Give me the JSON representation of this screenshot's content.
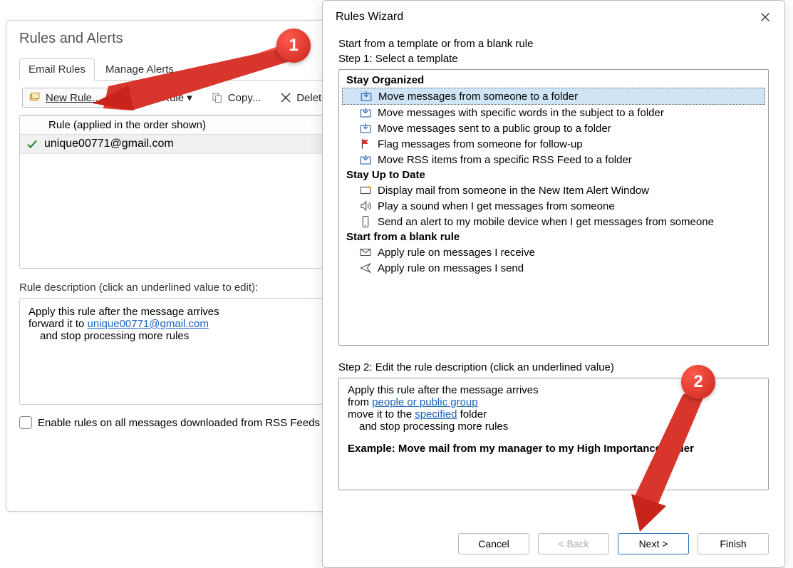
{
  "back": {
    "title": "Rules and Alerts",
    "tabs": {
      "email_rules": "Email Rules",
      "manage_alerts": "Manage Alerts"
    },
    "toolbar": {
      "new_rule": "New Rule...",
      "change_rule": "Change Rule",
      "copy": "Copy...",
      "delete": "Delete"
    },
    "list": {
      "header": "Rule (applied in the order shown)",
      "rows": [
        "unique00771@gmail.com"
      ]
    },
    "descr_label": "Rule description (click an underlined value to edit):",
    "descr": {
      "line1": "Apply this rule after the message arrives",
      "line2_pre": "forward it to ",
      "line2_link": "unique00771@gmail.com",
      "line3": "and stop processing more rules"
    },
    "rss_checkbox": "Enable rules on all messages downloaded from RSS Feeds"
  },
  "wizard": {
    "title": "Rules Wizard",
    "intro": "Start from a template or from a blank rule",
    "step1_label": "Step 1: Select a template",
    "groups": [
      {
        "heading": "Stay Organized",
        "items": [
          {
            "icon": "move-folder",
            "label": "Move messages from someone to a folder",
            "selected": true
          },
          {
            "icon": "move-folder",
            "label": "Move messages with specific words in the subject to a folder"
          },
          {
            "icon": "move-folder",
            "label": "Move messages sent to a public group to a folder"
          },
          {
            "icon": "flag",
            "label": "Flag messages from someone for follow-up"
          },
          {
            "icon": "rss-move",
            "label": "Move RSS items from a specific RSS Feed to a folder"
          }
        ]
      },
      {
        "heading": "Stay Up to Date",
        "items": [
          {
            "icon": "alert-mail",
            "label": "Display mail from someone in the New Item Alert Window"
          },
          {
            "icon": "sound",
            "label": "Play a sound when I get messages from someone"
          },
          {
            "icon": "mobile",
            "label": "Send an alert to my mobile device when I get messages from someone"
          }
        ]
      },
      {
        "heading": "Start from a blank rule",
        "items": [
          {
            "icon": "mail-in",
            "label": "Apply rule on messages I receive"
          },
          {
            "icon": "mail-out",
            "label": "Apply rule on messages I send"
          }
        ]
      }
    ],
    "step2_label": "Step 2: Edit the rule description (click an underlined value)",
    "descr": {
      "line1": "Apply this rule after the message arrives",
      "line2_pre": "from ",
      "line2_link": "people or public group",
      "line3_pre": "move it to the ",
      "line3_link": "specified",
      "line3_post": " folder",
      "line4": "and stop processing more rules",
      "example": "Example: Move mail from my manager to my High Importance folder"
    },
    "buttons": {
      "cancel": "Cancel",
      "back": "< Back",
      "next": "Next >",
      "finish": "Finish"
    }
  },
  "annotations": {
    "badge1": "1",
    "badge2": "2"
  }
}
